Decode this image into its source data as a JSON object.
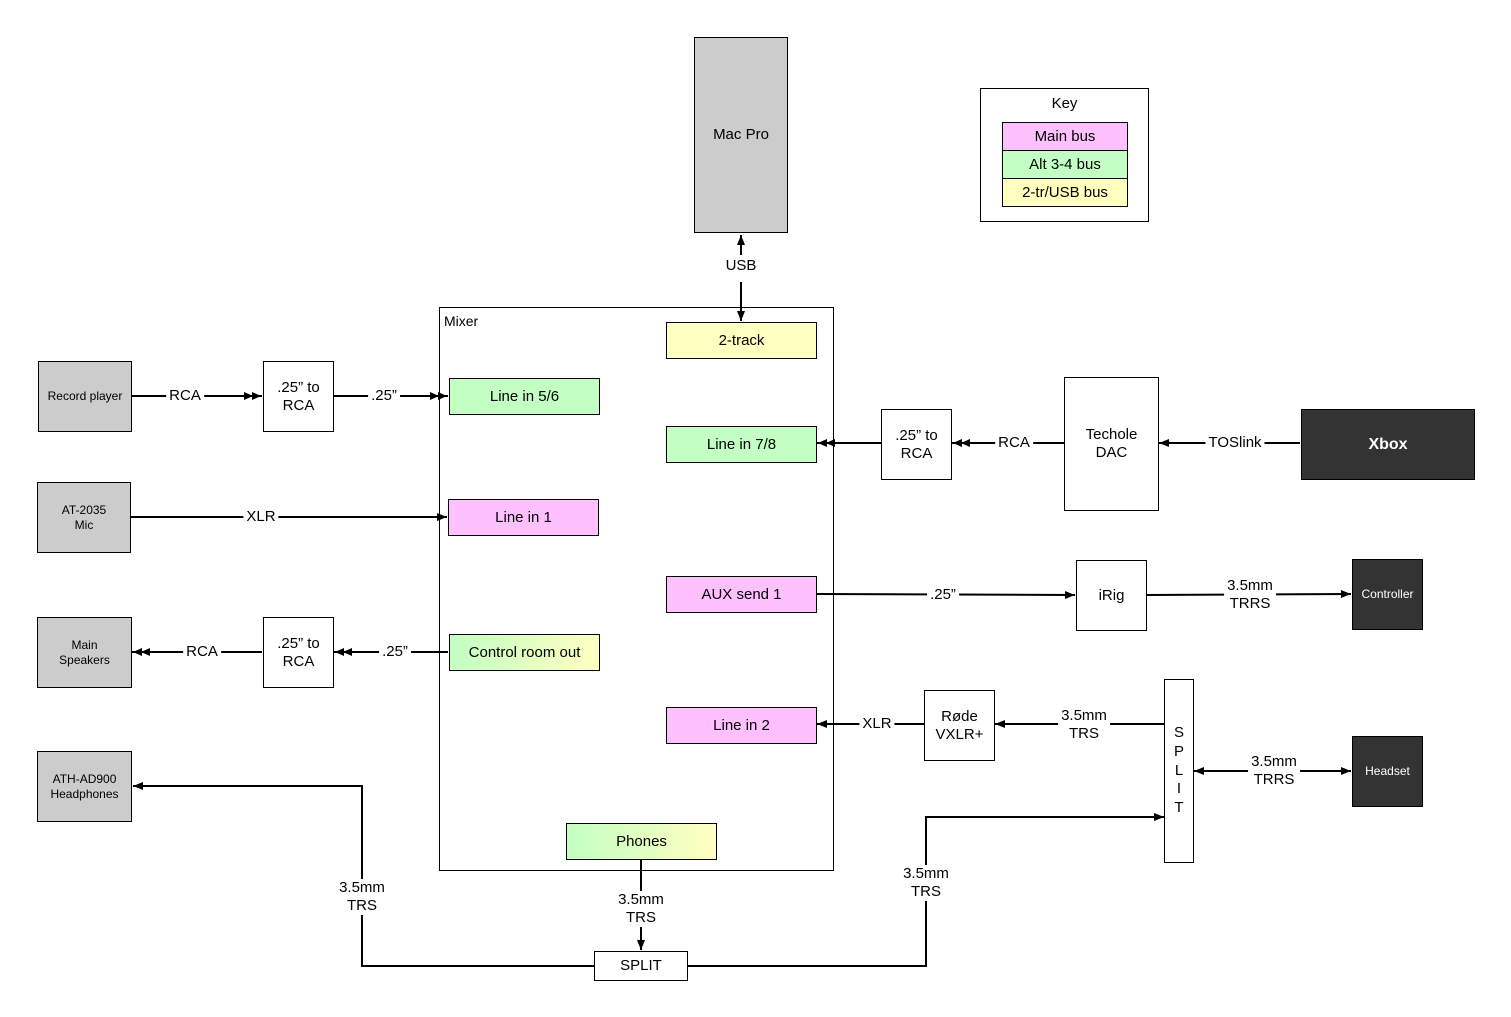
{
  "colors": {
    "main_bus": "#ffc0ff",
    "alt_bus": "#c3ffc3",
    "usb_bus": "#ffffc0",
    "device_gray": "#cccccc",
    "device_dark": "#333333"
  },
  "key": {
    "title": "Key",
    "items": [
      {
        "label": "Main bus",
        "bus": "main"
      },
      {
        "label": "Alt 3-4 bus",
        "bus": "alt"
      },
      {
        "label": "2-tr/USB bus",
        "bus": "usb"
      }
    ]
  },
  "devices": {
    "mac_pro": "Mac Pro",
    "record_player": "Record player",
    "mic": [
      "AT-2035",
      "Mic"
    ],
    "main_speakers": [
      "Main",
      "Speakers"
    ],
    "headphones": [
      "ATH-AD900",
      "Headphones"
    ],
    "xbox": "Xbox",
    "controller": "Controller",
    "headset": "Headset"
  },
  "adapters": {
    "rca_adapter_in": [
      ".25” to",
      "RCA"
    ],
    "rca_adapter_out": [
      ".25” to",
      "RCA"
    ],
    "rca_adapter_xbox": [
      ".25” to",
      "RCA"
    ],
    "dac": [
      "Techole",
      "DAC"
    ],
    "irig": "iRig",
    "rode": [
      "Røde",
      "VXLR+"
    ],
    "split_bottom": "SPLIT",
    "split_vertical": [
      "S",
      "P",
      "L",
      "I",
      "T"
    ]
  },
  "mixer": {
    "title": "Mixer",
    "ports": {
      "two_track": {
        "label": "2-track",
        "bus": "usb"
      },
      "line_5_6": {
        "label": "Line in 5/6",
        "bus": "alt"
      },
      "line_7_8": {
        "label": "Line in 7/8",
        "bus": "alt"
      },
      "line_1": {
        "label": "Line in 1",
        "bus": "main"
      },
      "aux_send_1": {
        "label": "AUX send 1",
        "bus": "main"
      },
      "control_room_out": {
        "label": "Control room out",
        "bus": "alt+usb"
      },
      "line_2": {
        "label": "Line in 2",
        "bus": "main"
      },
      "phones": {
        "label": "Phones",
        "bus": "alt+usb"
      }
    }
  },
  "connections": {
    "usb": "USB",
    "rp_rca": "RCA",
    "rp_quarter": ".25”",
    "mic_xlr": "XLR",
    "spk_rca": "RCA",
    "spk_quarter": ".25”",
    "dac_rca": "RCA",
    "toslink": "TOSlink",
    "aux_quarter": ".25”",
    "irig_trrs": [
      "3.5mm",
      "TRRS"
    ],
    "rode_xlr": "XLR",
    "split_trs": [
      "3.5mm",
      "TRS"
    ],
    "headset_trrs": [
      "3.5mm",
      "TRRS"
    ],
    "phones_trs": [
      "3.5mm",
      "TRS"
    ],
    "hp_trs": [
      "3.5mm",
      "TRS"
    ],
    "split_to_vsplit_trs": [
      "3.5mm",
      "TRS"
    ]
  }
}
